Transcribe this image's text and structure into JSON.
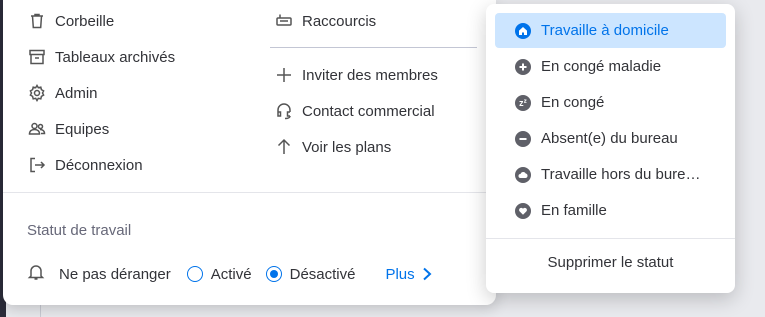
{
  "main_menu": {
    "left_items": [
      {
        "label": "Corbeille",
        "icon": "trash-icon"
      },
      {
        "label": "Tableaux archivés",
        "icon": "archive-icon"
      },
      {
        "label": "Admin",
        "icon": "gear-icon"
      },
      {
        "label": "Equipes",
        "icon": "team-icon"
      },
      {
        "label": "Déconnexion",
        "icon": "logout-icon"
      }
    ],
    "right_items": [
      {
        "label": "Raccourcis",
        "icon": "keyboard-icon"
      },
      {
        "label": "Inviter des membres",
        "icon": "plus-icon"
      },
      {
        "label": "Contact commercial",
        "icon": "headset-icon"
      },
      {
        "label": "Voir les plans",
        "icon": "arrow-up-icon"
      }
    ]
  },
  "work_status": {
    "title": "Statut de travail",
    "dnd_label": "Ne pas déranger",
    "options": [
      {
        "label": "Activé",
        "checked": false
      },
      {
        "label": "Désactivé",
        "checked": true
      }
    ],
    "more_label": "Plus"
  },
  "status_menu": {
    "items": [
      {
        "label": "Travaille à domicile",
        "icon": "home-icon",
        "selected": true
      },
      {
        "label": "En congé maladie",
        "icon": "plus-circle-icon",
        "selected": false
      },
      {
        "label": "En congé",
        "icon": "zzz-icon",
        "selected": false
      },
      {
        "label": "Absent(e) du bureau",
        "icon": "minus-circle-icon",
        "selected": false
      },
      {
        "label": "Travaille hors du bure…",
        "icon": "cloud-icon",
        "selected": false
      },
      {
        "label": "En famille",
        "icon": "heart-icon",
        "selected": false
      }
    ],
    "remove_label": "Supprimer le statut"
  },
  "colors": {
    "accent": "#0073ea",
    "selected_bg": "#cce5ff",
    "text": "#323338"
  }
}
